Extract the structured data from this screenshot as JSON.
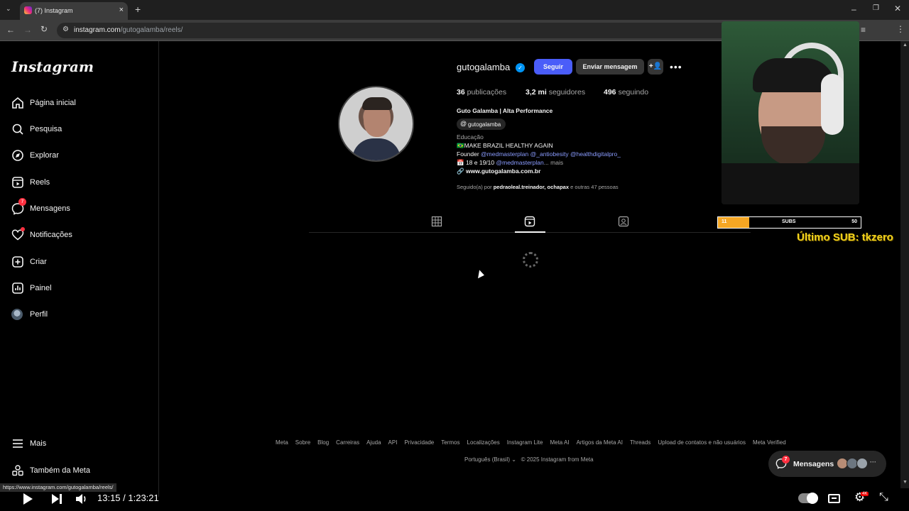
{
  "browser": {
    "tab_title": "(7) Instagram",
    "tab_close": "×",
    "new_tab": "+",
    "url_host": "instagram.com",
    "url_path": "/gutogalamba/reels/",
    "status_url": "https://www.instagram.com/gutogalamba/reels/"
  },
  "sidebar": {
    "logo": "Instagram",
    "items": [
      {
        "label": "Página inicial",
        "icon": "home-icon"
      },
      {
        "label": "Pesquisa",
        "icon": "search-icon"
      },
      {
        "label": "Explorar",
        "icon": "compass-icon"
      },
      {
        "label": "Reels",
        "icon": "reels-icon"
      },
      {
        "label": "Mensagens",
        "icon": "messenger-icon",
        "badge": "7"
      },
      {
        "label": "Notificações",
        "icon": "heart-icon"
      },
      {
        "label": "Criar",
        "icon": "plus-square-icon"
      },
      {
        "label": "Painel",
        "icon": "chart-icon"
      },
      {
        "label": "Perfil",
        "icon": "avatar-icon"
      }
    ],
    "more": "Mais",
    "meta": "Também da Meta"
  },
  "profile": {
    "username": "gutogalamba",
    "follow_label": "Seguir",
    "message_label": "Enviar mensagem",
    "posts_count": "36",
    "posts_label": "publicações",
    "followers_count": "3,2 mi",
    "followers_label": "seguidores",
    "following_count": "496",
    "following_label": "seguindo",
    "full_name": "Guto Galamba | Alta Performance",
    "threads_handle": "gutogalamba",
    "category": "Educação",
    "bio_line1": "🇧🇷MAKE BRAZIL HEALTHY AGAIN",
    "bio_line2_prefix": "Founder ",
    "bio_line2_mentions": "@medmasterplan @_antiobesity @healthdigitalpro_",
    "bio_line3_prefix": "📅 18 e 19/10 ",
    "bio_line3_mention": "@medmasterplan",
    "bio_line3_more": "... mais",
    "website": "www.gutogalamba.com.br",
    "followed_by_prefix": "Seguido(a) por ",
    "followed_by_names": "pedraoleal.treinador, ochapax",
    "followed_by_suffix": " e outras 47 pessoas"
  },
  "footer": {
    "links": [
      "Meta",
      "Sobre",
      "Blog",
      "Carreiras",
      "Ajuda",
      "API",
      "Privacidade",
      "Termos",
      "Localizações",
      "Instagram Lite",
      "Meta AI",
      "Artigos da Meta AI",
      "Threads",
      "Upload de contatos e não usuários",
      "Meta Verified"
    ],
    "language": "Português (Brasil)",
    "copyright": "© 2025 Instagram from Meta"
  },
  "messages_bubble": {
    "label": "Mensagens",
    "badge": "7"
  },
  "overlay": {
    "subs_current": "11",
    "subs_label": "SUBS",
    "subs_goal": "50",
    "subs_fraction": 0.22,
    "last_sub": "Último SUB: tkzero"
  },
  "player": {
    "timecode": "13:15 / 1:23:21"
  },
  "colors": {
    "accent": "#4a5df9",
    "verified": "#0095f6",
    "badge": "#ff3040",
    "subs_fill": "#f5a623",
    "last_sub": "#f2d21c"
  }
}
